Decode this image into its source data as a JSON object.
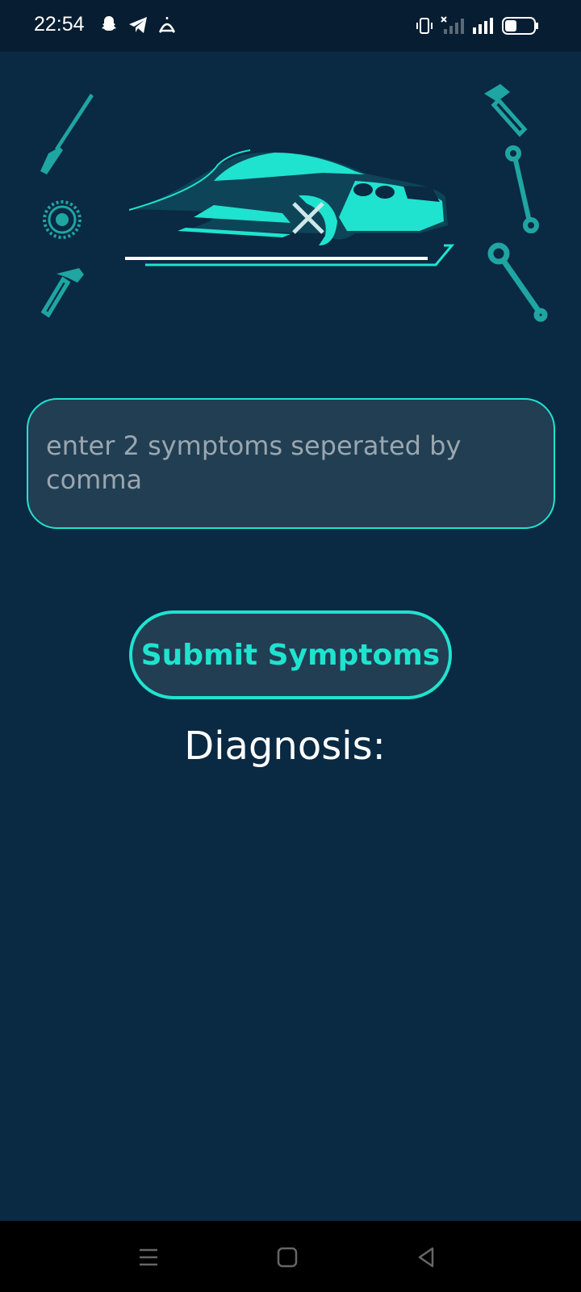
{
  "status_bar": {
    "time": "22:54",
    "left_icons": [
      "snapchat-icon",
      "telegram-icon",
      "alarm-icon"
    ],
    "right_icons": [
      "vibrate-icon",
      "signal-no-service-icon",
      "signal-icon",
      "battery-icon"
    ]
  },
  "header_graphic": {
    "icons": [
      "screwdriver-icon",
      "gear-icon",
      "hammer-icon",
      "car-repair-logo",
      "hammer-icon",
      "wrench-icon",
      "adjustable-wrench-icon"
    ]
  },
  "symptom_input": {
    "value": "",
    "placeholder": "enter 2 symptoms seperated by comma"
  },
  "submit_button": {
    "label": "Submit Symptoms"
  },
  "diagnosis": {
    "label": "Diagnosis:"
  },
  "nav_bar": {
    "icons": [
      "menu-icon",
      "home-icon",
      "back-icon"
    ]
  },
  "colors": {
    "background": "#0a2942",
    "accent": "#1fe3cf",
    "field": "#223e53"
  }
}
